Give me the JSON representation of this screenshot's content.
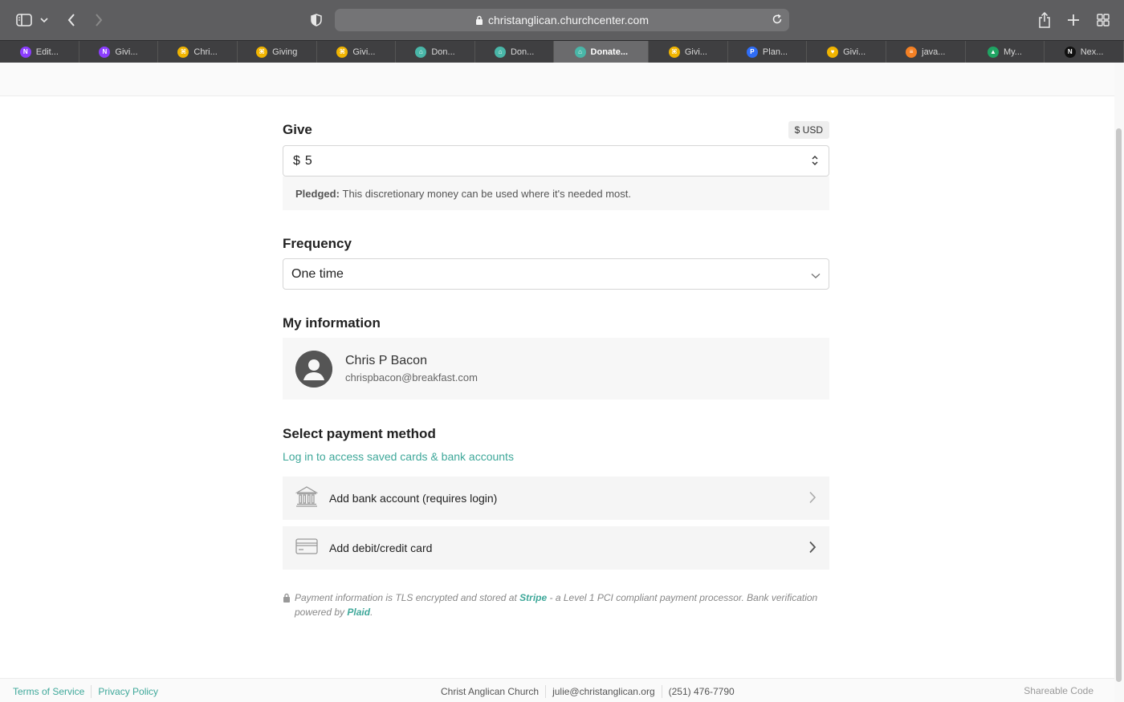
{
  "browser": {
    "url": "christanglican.churchcenter.com",
    "tabs": [
      {
        "label": "Edit...",
        "icon": "N",
        "color": "#8b3dff",
        "active": false
      },
      {
        "label": "Givi...",
        "icon": "N",
        "color": "#8b3dff",
        "active": false
      },
      {
        "label": "Chri...",
        "icon": "⌘",
        "color": "#f0b400",
        "active": false
      },
      {
        "label": "Giving",
        "icon": "⌘",
        "color": "#f0b400",
        "active": false
      },
      {
        "label": "Givi...",
        "icon": "⌘",
        "color": "#f0b400",
        "active": false
      },
      {
        "label": "Don...",
        "icon": "⌂",
        "color": "#49b6a8",
        "active": false
      },
      {
        "label": "Don...",
        "icon": "⌂",
        "color": "#49b6a8",
        "active": false
      },
      {
        "label": "Donate...",
        "icon": "⌂",
        "color": "#49b6a8",
        "active": true
      },
      {
        "label": "Givi...",
        "icon": "⌘",
        "color": "#f0b400",
        "active": false
      },
      {
        "label": "Plan...",
        "icon": "P",
        "color": "#2f6df6",
        "active": false
      },
      {
        "label": "Givi...",
        "icon": "♥",
        "color": "#f0b400",
        "active": false
      },
      {
        "label": "java...",
        "icon": "≡",
        "color": "#f48024",
        "active": false
      },
      {
        "label": "My...",
        "icon": "▲",
        "color": "#1fa463",
        "active": false
      },
      {
        "label": "Nex...",
        "icon": "N",
        "color": "#111111",
        "active": false
      }
    ]
  },
  "give": {
    "title": "Give",
    "currency_badge": "$ USD",
    "currency_symbol": "$",
    "amount": "5",
    "pledged_label": "Pledged:",
    "pledged_text": "This discretionary money can be used where it's needed most."
  },
  "frequency": {
    "title": "Frequency",
    "selected": "One time"
  },
  "my_information": {
    "title": "My information",
    "name": "Chris P Bacon",
    "email": "chrispbacon@breakfast.com"
  },
  "payment": {
    "title": "Select payment method",
    "login_link": "Log in to access saved cards & bank accounts",
    "bank_label": "Add bank account (requires login)",
    "card_label": "Add debit/credit card",
    "secure_text_1": "Payment information is TLS encrypted and stored at ",
    "stripe": "Stripe",
    "secure_text_2": " - a Level 1 PCI compliant payment processor. Bank verification powered by ",
    "plaid": "Plaid",
    "secure_text_3": "."
  },
  "footer": {
    "terms": "Terms of Service",
    "privacy": "Privacy Policy",
    "church": "Christ Anglican Church",
    "email": "julie@christanglican.org",
    "phone": "(251) 476-7790",
    "shareable": "Shareable Code"
  },
  "colors": {
    "accent": "#3fa89a"
  }
}
